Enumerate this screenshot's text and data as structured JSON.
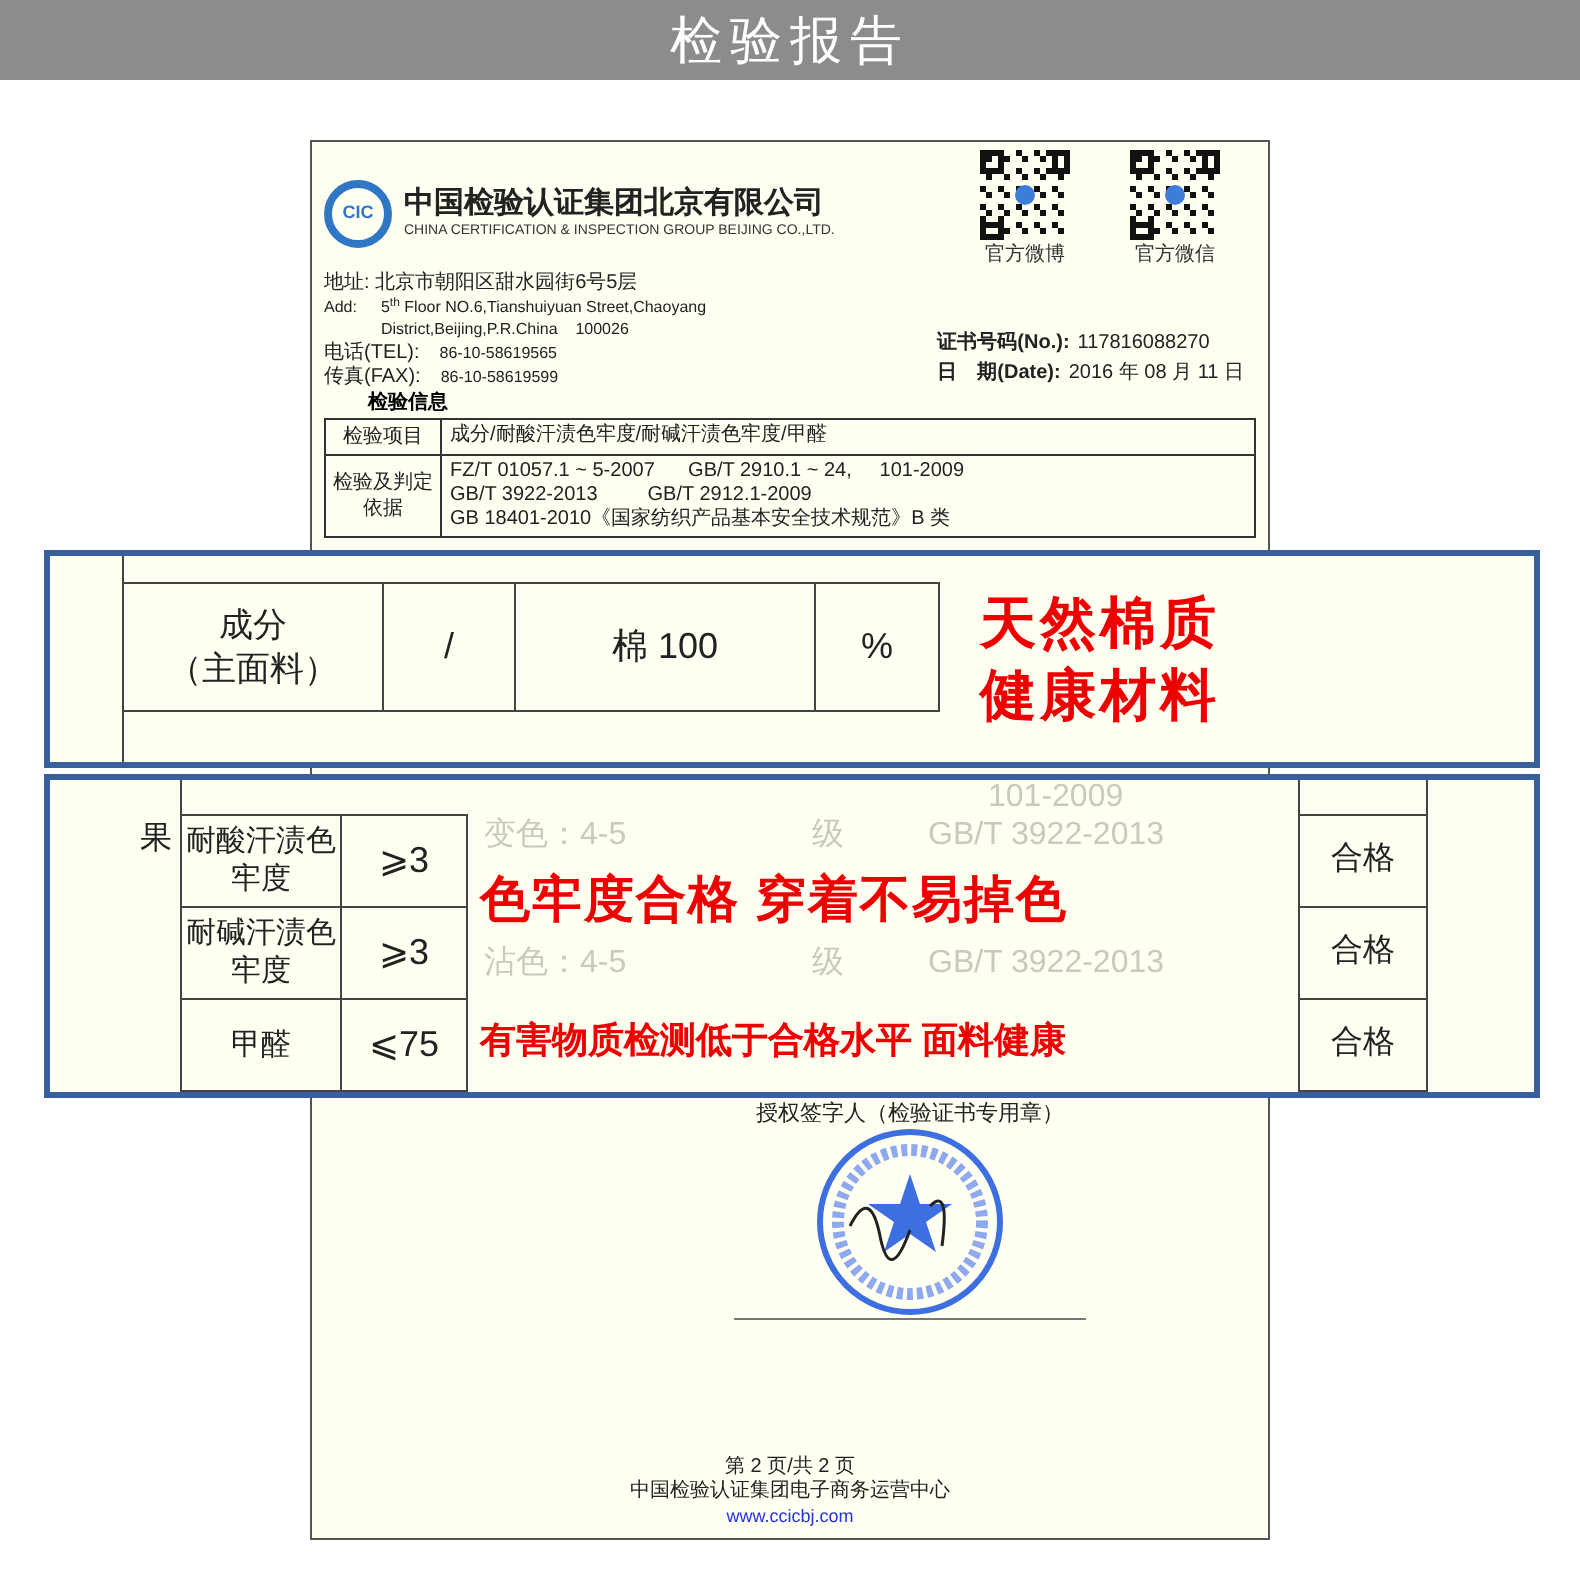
{
  "banner": {
    "title": "检验报告"
  },
  "document": {
    "logo_text": "CIC",
    "company_cn": "中国检验认证集团北京有限公司",
    "company_en": "CHINA CERTIFICATION & INSPECTION GROUP BEIJING CO.,LTD.",
    "qr_codes": [
      {
        "caption": "官方微博"
      },
      {
        "caption": "官方微信"
      }
    ],
    "address_cn": {
      "label": "地址:",
      "value": "北京市朝阳区甜水园街6号5层"
    },
    "address_en": {
      "label": "Add:",
      "lines": [
        "5$^{th}$ Floor NO.6,Tianshuiyuan Street,Chaoyang",
        "District,Beijing,P.R.China    100026"
      ]
    },
    "contacts": [
      {
        "label": "电话(TEL):",
        "value": "86-10-58619565"
      },
      {
        "label": "传真(FAX):",
        "value": "86-10-58619599"
      }
    ],
    "certificate": [
      {
        "label": "证书号码(No.):",
        "value": "117816088270"
      },
      {
        "label": "日　期(Date):",
        "value": "2016 年 08 月 11 日"
      }
    ],
    "section_title": "检验信息",
    "info_rows": [
      {
        "label": "检验项目",
        "lines": [
          "成分/耐酸汗渍色牢度/耐碱汗渍色牢度/甲醛"
        ]
      },
      {
        "label": "检验及判定依据",
        "lines": [
          "FZ/T 01057.1 ~ 5-2007      GB/T 2910.1 ~ 24,     101-2009",
          "GB/T 3922-2013         GB/T 2912.1-2009",
          "GB 18401-2010《国家纺织产品基本安全技术规范》B 类"
        ]
      }
    ],
    "signatory": "授权签字人（检验证书专用章）",
    "footer": {
      "page": "第 2 页/共 2 页",
      "org": "中国检验认证集团电子商务运营中心",
      "url": "www.ccicbj.com"
    }
  },
  "highlight_1": {
    "item_lines": [
      "成分",
      "（主面料）"
    ],
    "limit": "/",
    "result": "棉 100",
    "unit": "%",
    "callout_lines": [
      "天然棉质",
      "健康材料"
    ]
  },
  "highlight_2": {
    "side_label": "果",
    "top_note": "101-2009",
    "rows": [
      {
        "item": "耐酸汗渍色牢度",
        "limit": "⩾3",
        "faded": "变色：4-5",
        "grade": "级",
        "method": "GB/T 3922-2013",
        "verdict": "合格"
      },
      {
        "item": "耐碱汗渍色牢度",
        "limit": "⩾3",
        "faded": "沾色：4-5",
        "grade": "级",
        "method": "GB/T 3922-2013",
        "verdict": "合格"
      },
      {
        "item": "甲醛",
        "limit": "⩽75",
        "verdict": "合格"
      }
    ],
    "callouts": [
      "色牢度合格 穿着不易掉色",
      "有害物质检测低于合格水平 面料健康"
    ]
  }
}
